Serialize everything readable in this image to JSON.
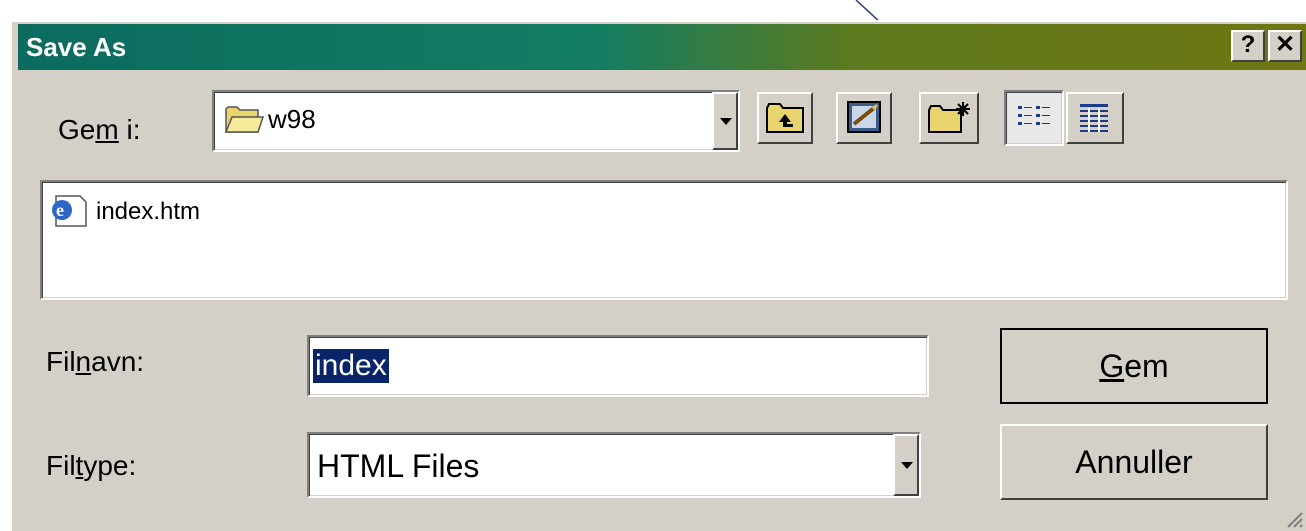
{
  "window": {
    "title": "Save As",
    "help_glyph": "?",
    "close_glyph": "✕"
  },
  "save_in": {
    "label_pre": "Ge",
    "label_accel": "m",
    "label_post": " i:",
    "value": "w98"
  },
  "file_list": [
    {
      "name": "index.htm",
      "icon": "ie-html-file-icon"
    }
  ],
  "filename": {
    "label_pre": "Fil",
    "label_accel": "n",
    "label_post": "avn:",
    "value": "index"
  },
  "filetype": {
    "label_pre": "Fil",
    "label_accel": "t",
    "label_post": "ype:",
    "value": "HTML Files"
  },
  "buttons": {
    "save_accel": "G",
    "save_rest": "em",
    "cancel": "Annuller"
  },
  "toolbar_icons": [
    "up-one-level-icon",
    "desktop-icon",
    "new-folder-icon",
    "list-view-icon",
    "details-view-icon"
  ]
}
